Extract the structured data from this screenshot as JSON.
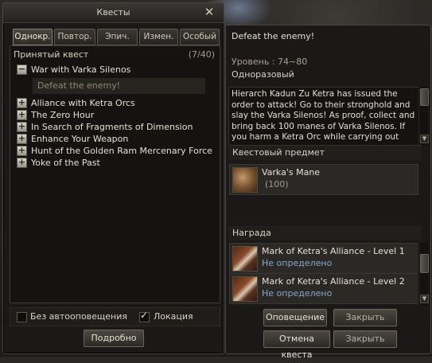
{
  "window_title": "Квесты",
  "tabs": [
    "Однокр.",
    "Повтор.",
    "Эпич.",
    "Измен.",
    "Особый"
  ],
  "accepted": {
    "label": "Принятый квест",
    "count": "(7/40)"
  },
  "quests": [
    {
      "name": "War with Varka Silenos",
      "expanded": true,
      "sub": "Defeat the enemy!"
    },
    {
      "name": "Alliance with Ketra Orcs",
      "expanded": false
    },
    {
      "name": "The Zero Hour",
      "expanded": false
    },
    {
      "name": "In Search of Fragments of Dimension",
      "expanded": false
    },
    {
      "name": "Enhance Your Weapon",
      "expanded": false
    },
    {
      "name": "Hunt of the Golden Ram Mercenary Force",
      "expanded": false
    },
    {
      "name": "Yoke of the Past",
      "expanded": false
    }
  ],
  "options": {
    "no_notify": "Без автооповещения",
    "location": "Локация"
  },
  "details_button": "Подробно",
  "detail": {
    "title": "Defeat the enemy!",
    "level_label": "Уровень :",
    "level_value": "74~80",
    "type": "Одноразовый",
    "description": "Hierarch Kadun Zu Ketra has issued the order to attack! Go to their stronghold and slay the Varka Silenos! As proof, collect and bring back 100 manes of Varka Silenos.\n If you harm a Ketra Orc while carrying out",
    "quest_item_header": "Квестовый предмет",
    "quest_item": {
      "name": "Varka's Mane",
      "qty": "(100)"
    },
    "reward_header": "Награда",
    "rewards": [
      {
        "name": "Mark of Ketra's Alliance - Level 1",
        "status": "Не определено"
      },
      {
        "name": "Mark of Ketra's Alliance - Level 2",
        "status": "Не определено"
      }
    ]
  },
  "buttons": {
    "notify": "Оповещение",
    "close1": "Закрыть",
    "cancel": "Отмена квеста",
    "close2": "Закрыть"
  }
}
